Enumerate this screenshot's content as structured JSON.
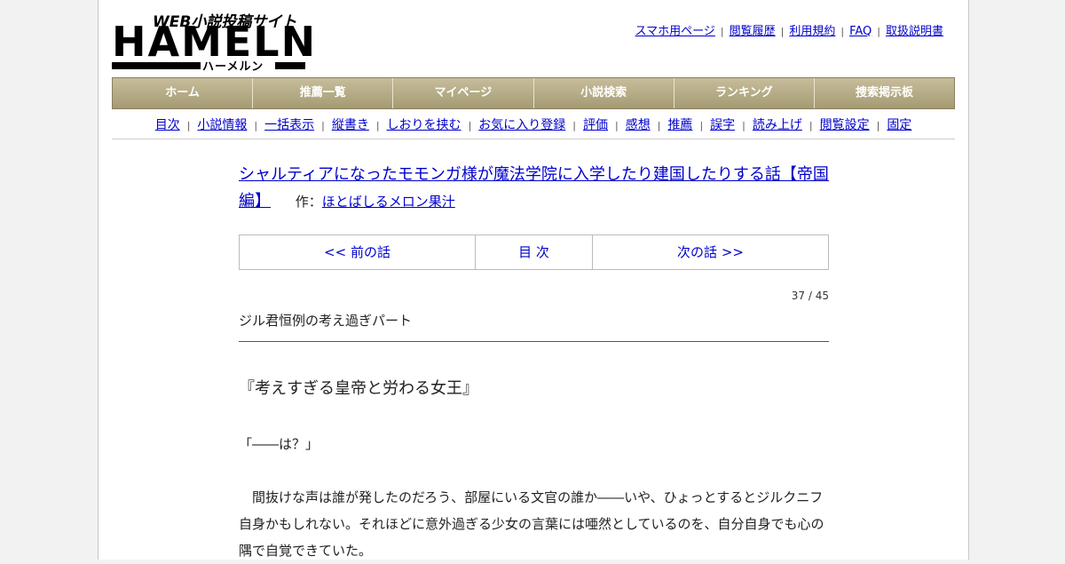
{
  "logo": {
    "sub": "WEB小説投稿サイト",
    "main": "HAMELN",
    "kana": "ハーメルン"
  },
  "toplinks": [
    "スマホ用ページ",
    "閲覧履歴",
    "利用規約",
    "FAQ",
    "取扱説明書"
  ],
  "mainnav": [
    "ホーム",
    "推薦一覧",
    "マイページ",
    "小説検索",
    "ランキング",
    "捜索掲示板"
  ],
  "subnav": [
    "目次",
    "小説情報",
    "一括表示",
    "縦書き",
    "しおりを挟む",
    "お気に入り登録",
    "評価",
    "感想",
    "推薦",
    "誤字",
    "読み上げ",
    "閲覧設定",
    "固定"
  ],
  "novel": {
    "title": "シャルティアになったモモンガ様が魔法学院に入学したり建国したりする話【帝国編】",
    "author_label": "作：",
    "author": "ほとばしるメロン果汁"
  },
  "episode_nav": {
    "prev": "<< 前の話",
    "toc": "目 次",
    "next": "次の話 >>"
  },
  "page_number": "37 / 45",
  "episode_subtitle": "ジル君恒例の考え過ぎパート",
  "text": {
    "heading": "『考えすぎる皇帝と労わる女王』",
    "line1": "「――は？」",
    "para": "　間抜けな声は誰が発したのだろう、部屋にいる文官の誰か――いや、ひょっとするとジルクニフ自身かもしれない。それほどに意外過ぎる少女の言葉には唖然としているのを、自分自身でも心の隅で自覚できていた。"
  },
  "colors": {
    "link": "#0000cc",
    "nav_bg": "#b4aa84",
    "nav_text": "#ffffff"
  }
}
